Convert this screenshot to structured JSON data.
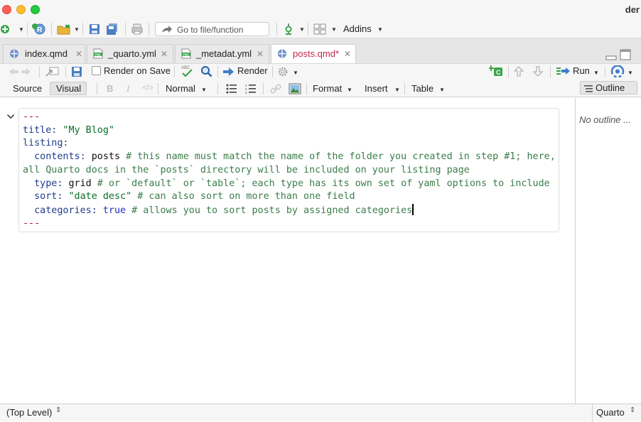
{
  "window": {
    "title_fragment": "der"
  },
  "main_toolbar": {
    "goto_placeholder": "Go to file/function",
    "addins_label": "Addins"
  },
  "tabs": [
    {
      "label": "index.qmd",
      "type": "qmd",
      "active": false,
      "modified": false
    },
    {
      "label": "_quarto.yml",
      "type": "yml",
      "active": false,
      "modified": false
    },
    {
      "label": "_metadat.yml",
      "type": "yml",
      "active": false,
      "modified": false
    },
    {
      "label": "posts.qmd*",
      "type": "qmd",
      "active": true,
      "modified": true
    }
  ],
  "editor_toolbar": {
    "render_on_save_label": "Render on Save",
    "render_on_save_checked": false,
    "render_label": "Render",
    "run_label": "Run"
  },
  "format_toolbar": {
    "source_label": "Source",
    "visual_label": "Visual",
    "bold_label": "B",
    "italic_label": "I",
    "code_label": "</>",
    "style_select": "Normal",
    "format_menu": "Format",
    "insert_menu": "Insert",
    "table_menu": "Table",
    "outline_label": "Outline"
  },
  "yaml_block": {
    "line1": "---",
    "line2_key": "title:",
    "line2_val": " \"My Blog\"",
    "line3_key": "listing:",
    "line4_key": "  contents:",
    "line4_val": " posts",
    "line4_comment": " # this name must match the name of the folder you created in step #1; here,",
    "line5_comment": "all Quarto docs in the `posts` directory will be included on your listing page",
    "line6_key": "  type:",
    "line6_val": " grid",
    "line6_comment": " # or `default` or `table`; each type has its own set of yaml options to include",
    "line7_key": "  sort:",
    "line7_val": " \"date desc\"",
    "line7_comment": " # can also sort on more than one field",
    "line8_key": "  categories:",
    "line8_val": " true",
    "line8_comment": " # allows you to sort posts by assigned categories",
    "line9": "---"
  },
  "outline": {
    "empty_text": "No outline ..."
  },
  "status": {
    "scope": "(Top Level)",
    "filetype": "Quarto"
  },
  "colors": {
    "accent_red": "#c5284c",
    "yaml_delim": "#a50063",
    "yaml_key": "#1e3c8c",
    "yaml_string": "#0a6f2b",
    "yaml_comment": "#3b7d4a"
  }
}
